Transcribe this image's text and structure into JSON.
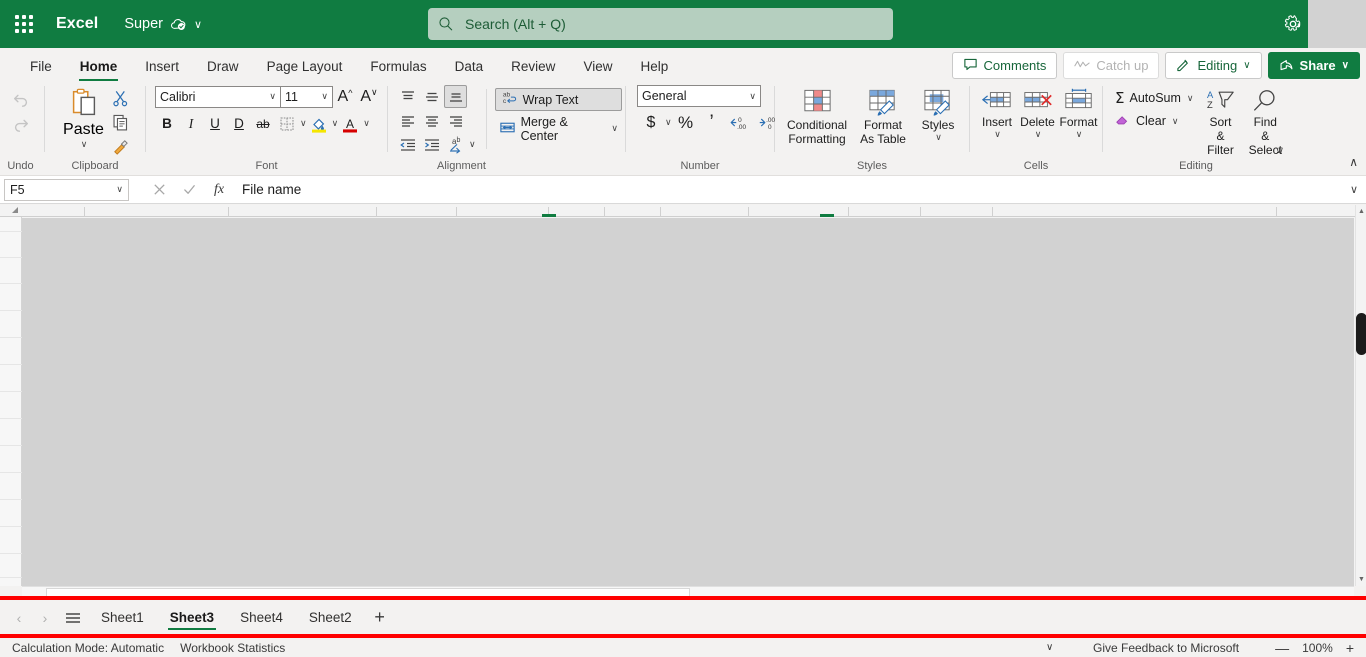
{
  "topbar": {
    "waffle_label": "App launcher",
    "brand": "Excel",
    "doc_name": "Super",
    "cloud_status_icon": "cloud-saved-icon",
    "doc_chevron": "∨",
    "search_placeholder": "Search (Alt + Q)",
    "search_value": "",
    "settings_icon": "gear-icon",
    "colors": {
      "green": "#107c41",
      "search_bg": "#b5cfbf"
    }
  },
  "ribbon_tabs": [
    {
      "label": "File",
      "active": false
    },
    {
      "label": "Home",
      "active": true
    },
    {
      "label": "Insert",
      "active": false
    },
    {
      "label": "Draw",
      "active": false
    },
    {
      "label": "Page Layout",
      "active": false
    },
    {
      "label": "Formulas",
      "active": false
    },
    {
      "label": "Data",
      "active": false
    },
    {
      "label": "Review",
      "active": false
    },
    {
      "label": "View",
      "active": false
    },
    {
      "label": "Help",
      "active": false
    }
  ],
  "right_tab_buttons": {
    "comments": "Comments",
    "catch_up": "Catch up",
    "editing": "Editing",
    "editing_chevron": "∨",
    "share": "Share",
    "share_chevron": "∨"
  },
  "ribbon": {
    "undo": {
      "group_label": "Undo",
      "undo_icon": "undo-icon",
      "redo_icon": "redo-icon"
    },
    "clipboard": {
      "group_label": "Clipboard",
      "paste_label": "Paste",
      "paste_chevron": "∨",
      "cut_icon": "scissors-icon",
      "copy_icon": "copy-icon",
      "format_painter_icon": "format-painter-icon"
    },
    "font": {
      "group_label": "Font",
      "font_name": "Calibri",
      "font_size": "11",
      "grow_font": "A",
      "shrink_font": "A",
      "bold": "B",
      "italic": "I",
      "underline": "U",
      "double_underline": "D",
      "strikethrough": "ab",
      "borders_icon": "borders-icon",
      "fill_color_icon": "fill-color-icon",
      "font_color_icon": "font-color-icon",
      "chevron": "∨"
    },
    "alignment": {
      "group_label": "Alignment",
      "top_align": "top-align-icon",
      "middle_align": "middle-align-icon",
      "bottom_align": "bottom-align-icon",
      "align_left": "align-left-icon",
      "align_center": "align-center-icon",
      "align_right": "align-right-icon",
      "decrease_indent": "decrease-indent-icon",
      "increase_indent": "increase-indent-icon",
      "orientation": "orientation-icon",
      "wrap_text": "Wrap Text",
      "wrap_text_selected": true,
      "merge_center": "Merge & Center",
      "merge_chevron": "∨"
    },
    "number": {
      "group_label": "Number",
      "format": "General",
      "format_chevron": "∨",
      "accounting": "$",
      "accounting_chevron": "∨",
      "percent": "%",
      "comma": "’",
      "increase_decimal": "increase-decimal-icon",
      "decrease_decimal": "decrease-decimal-icon"
    },
    "styles": {
      "group_label": "Styles",
      "conditional_formatting": "Conditional Formatting",
      "format_as_table": "Format As Table",
      "styles": "Styles",
      "chevron": "∨"
    },
    "cells": {
      "group_label": "Cells",
      "insert": "Insert",
      "delete": "Delete",
      "format": "Format",
      "chevron": "∨"
    },
    "editing": {
      "group_label": "Editing",
      "autosum": "AutoSum",
      "clear": "Clear",
      "sort_filter": "Sort & Filter",
      "find_select": "Find & Select",
      "chevron": "∨"
    },
    "collapse_icon": "∧"
  },
  "formula_bar": {
    "name_box_value": "F5",
    "name_box_chevron": "∨",
    "cancel_icon": "cancel-icon",
    "enter_icon": "enter-icon",
    "fx_label": "fx",
    "formula_value": "File name",
    "expand_chevron": "∨"
  },
  "grid": {
    "overlay_color": "#d2d2d2",
    "selected_cell": "F5"
  },
  "sheet_tabs": {
    "prev_icon": "‹",
    "next_icon": "›",
    "all_sheets_icon": "all-sheets-icon",
    "tabs": [
      {
        "label": "Sheet1",
        "active": false
      },
      {
        "label": "Sheet3",
        "active": true
      },
      {
        "label": "Sheet4",
        "active": false
      },
      {
        "label": "Sheet2",
        "active": false
      }
    ],
    "add_sheet": "+"
  },
  "status_bar": {
    "calculation_mode": "Calculation Mode: Automatic",
    "workbook_statistics": "Workbook Statistics",
    "overflow_chevron": "∨",
    "feedback": "Give Feedback to Microsoft",
    "zoom_out": "—",
    "zoom_level": "100%",
    "zoom_in": "+"
  }
}
